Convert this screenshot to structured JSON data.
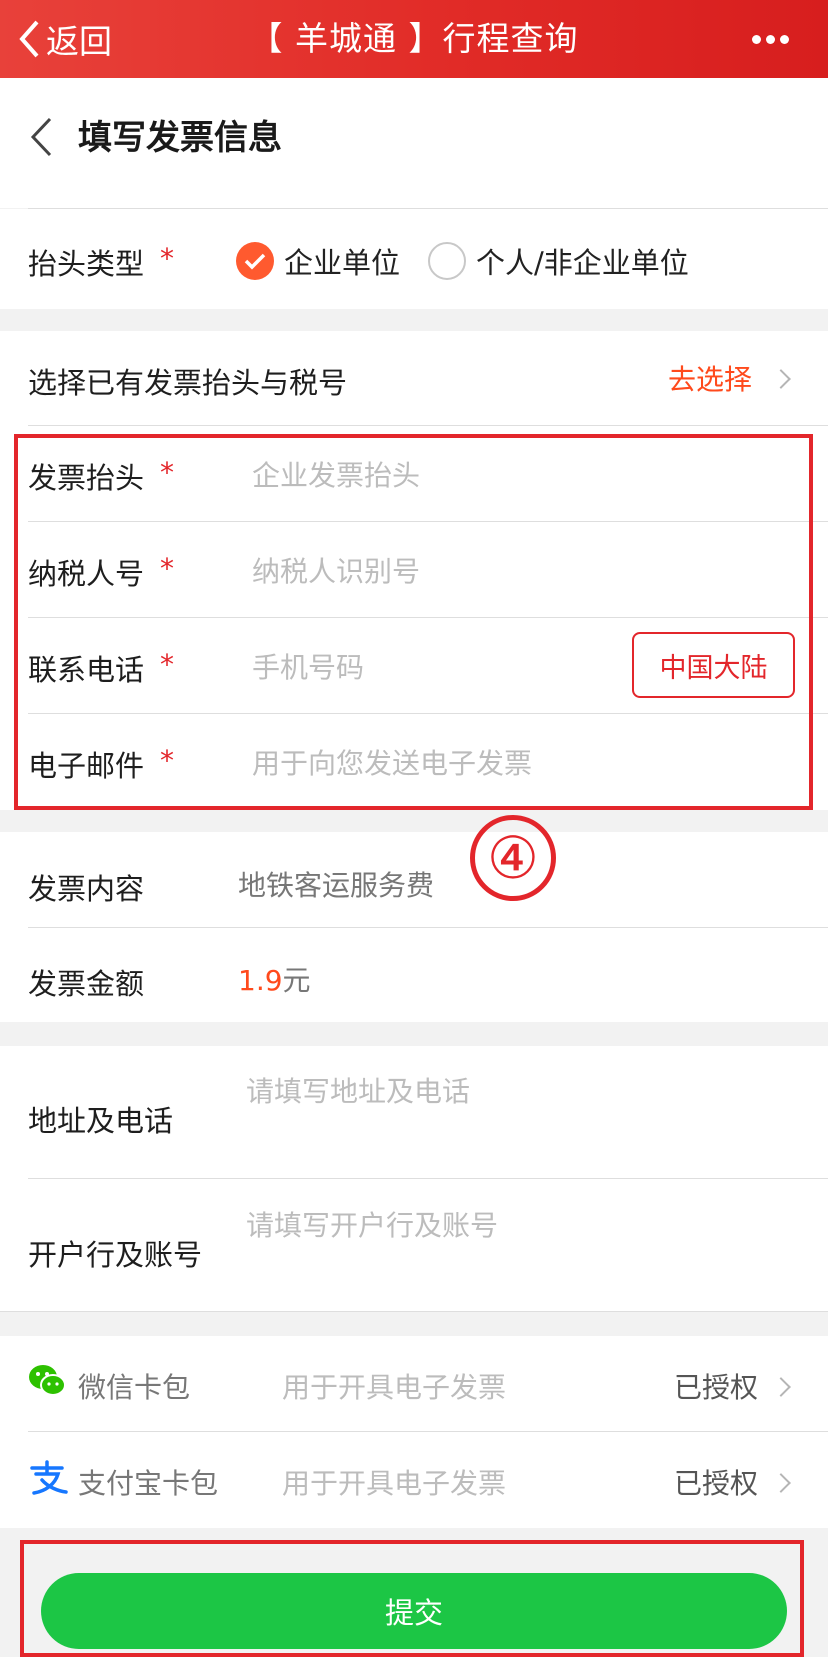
{
  "topbar": {
    "back_label": "返回",
    "title": "【 羊城通 】行程查询"
  },
  "page": {
    "title": "填写发票信息"
  },
  "header_type": {
    "label": "抬头类型",
    "required_mark": "*",
    "options": [
      {
        "label": "企业单位",
        "selected": true
      },
      {
        "label": "个人/非企业单位",
        "selected": false
      }
    ]
  },
  "select_existing": {
    "label": "选择已有发票抬头与税号",
    "action": "去选择"
  },
  "fields": {
    "invoice_title": {
      "label": "发票抬头",
      "required_mark": "*",
      "placeholder": "企业发票抬头"
    },
    "tax_id": {
      "label": "纳税人号",
      "required_mark": "*",
      "placeholder": "纳税人识别号"
    },
    "phone": {
      "label": "联系电话",
      "required_mark": "*",
      "placeholder": "手机号码",
      "region": "中国大陆"
    },
    "email": {
      "label": "电子邮件",
      "required_mark": "*",
      "placeholder": "用于向您发送电子发票"
    }
  },
  "callout_number": "④",
  "invoice_content": {
    "label": "发票内容",
    "value": "地铁客运服务费"
  },
  "invoice_amount": {
    "label": "发票金额",
    "amount": "1.9",
    "unit": "元"
  },
  "address_phone": {
    "label": "地址及电话",
    "placeholder": "请填写地址及电话"
  },
  "bank_account": {
    "label": "开户行及账号",
    "placeholder": "请填写开户行及账号"
  },
  "wallets": {
    "wechat": {
      "label": "微信卡包",
      "hint": "用于开具电子发票",
      "status": "已授权"
    },
    "alipay": {
      "label": "支付宝卡包",
      "hint": "用于开具电子发票",
      "status": "已授权"
    }
  },
  "submit_label": "提交",
  "colors": {
    "accent_red": "#e3262b",
    "selected_orange": "#ff5a2f",
    "submit_green": "#1cc645",
    "wechat_green": "#2dc100",
    "alipay_blue": "#1677ff"
  }
}
